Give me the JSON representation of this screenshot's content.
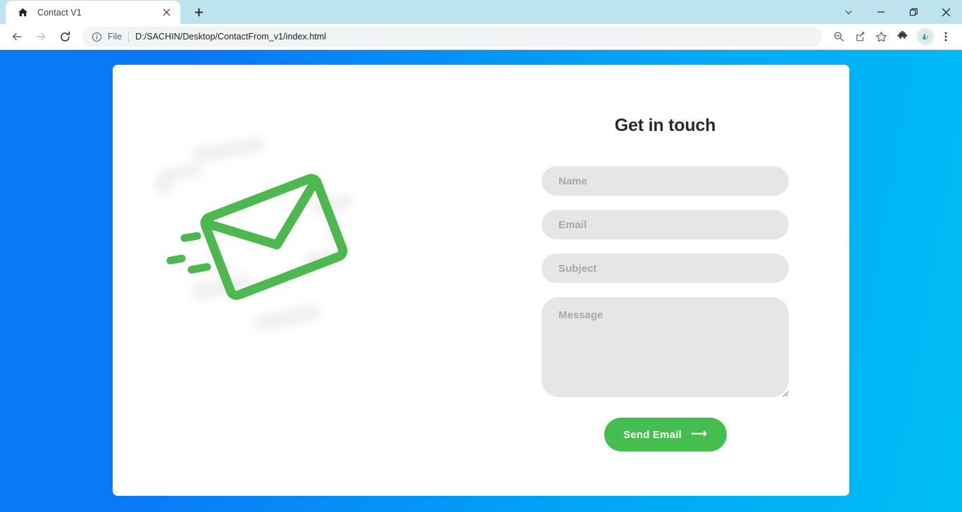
{
  "browser": {
    "tab": {
      "favicon": "home-icon",
      "title": "Contact V1",
      "close": "×"
    },
    "new_tab_label": "+",
    "window_controls": {
      "chevron": "⌄",
      "minimize": "—",
      "restore": "❐",
      "close": "✕"
    },
    "nav": {
      "back": "←",
      "forward": "→",
      "reload": "⟳"
    },
    "omnibox": {
      "info_icon": "info-circle-icon",
      "scheme_label": "File",
      "url": "D:/SACHIN/Desktop/ContactFrom_v1/index.html"
    },
    "toolbar_icons": {
      "zoom_out": "zoom-out-icon",
      "share": "share-icon",
      "bookmark": "star-icon",
      "extensions": "puzzle-icon",
      "profile": "profile-avatar",
      "menu": "three-dot-menu-icon"
    }
  },
  "page": {
    "background_gradient_from": "#0a78f7",
    "background_gradient_to": "#00bdf5",
    "illustration": {
      "name": "flying-envelope-illustration",
      "color": "#4cb84f"
    },
    "form": {
      "title": "Get in touch",
      "fields": [
        {
          "name": "name",
          "placeholder": "Name",
          "value": ""
        },
        {
          "name": "email",
          "placeholder": "Email",
          "value": ""
        },
        {
          "name": "subject",
          "placeholder": "Subject",
          "value": ""
        }
      ],
      "message": {
        "placeholder": "Message",
        "value": ""
      },
      "submit": {
        "label": "Send Email",
        "arrow": "⟶",
        "color": "#45bd4f"
      }
    }
  }
}
